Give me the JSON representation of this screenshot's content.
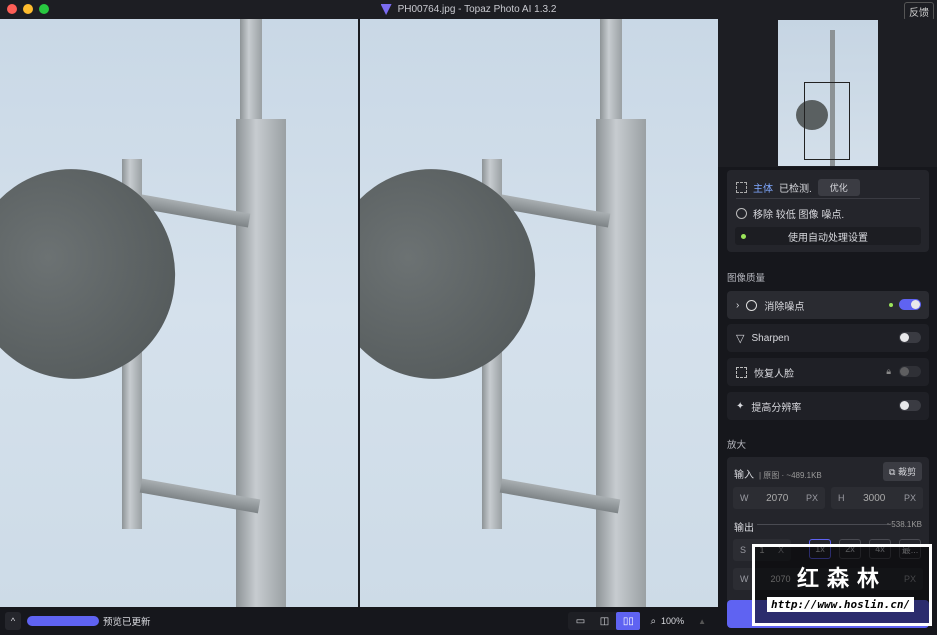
{
  "window": {
    "title": "PH00764.jpg - Topaz Photo AI 1.3.2",
    "feedback": "反馈"
  },
  "colors": {
    "accent": "#5f63f2",
    "green": "#9be55a",
    "subject": "#7fa8ff"
  },
  "sidebar": {
    "detect": {
      "subject": "主体",
      "detected": "已检测.",
      "optimize": "优化"
    },
    "noise_hint": "移除 较低 图像 噪点.",
    "auto_settings": "使用自动处理设置",
    "quality_label": "图像质量",
    "items": [
      {
        "label": "消除噪点",
        "enabled": true
      },
      {
        "label": "Sharpen",
        "enabled": false
      },
      {
        "label": "恢复人脸",
        "enabled": false,
        "locked": true
      },
      {
        "label": "提高分辨率",
        "enabled": false
      }
    ],
    "upscale": {
      "label": "放大",
      "input_label": "输入",
      "input_meta": "| 原图 · ~489.1KB",
      "crop": "裁剪",
      "w_label": "W",
      "w": "2070",
      "h_label": "H",
      "h": "3000",
      "unit": "PX",
      "output_label": "输出",
      "output_size": "~538.1KB",
      "s_label": "S",
      "scale": "1",
      "scale_unit": "X",
      "presets": [
        "1x",
        "2x",
        "4x",
        "最..."
      ],
      "out_w_label": "W",
      "out_w": "2070",
      "out_unit": "PX"
    }
  },
  "bottom": {
    "status": "预览已更新",
    "zoom": "100%"
  },
  "watermark": {
    "name": "红森林",
    "url": "http://www.hoslin.cn/"
  }
}
